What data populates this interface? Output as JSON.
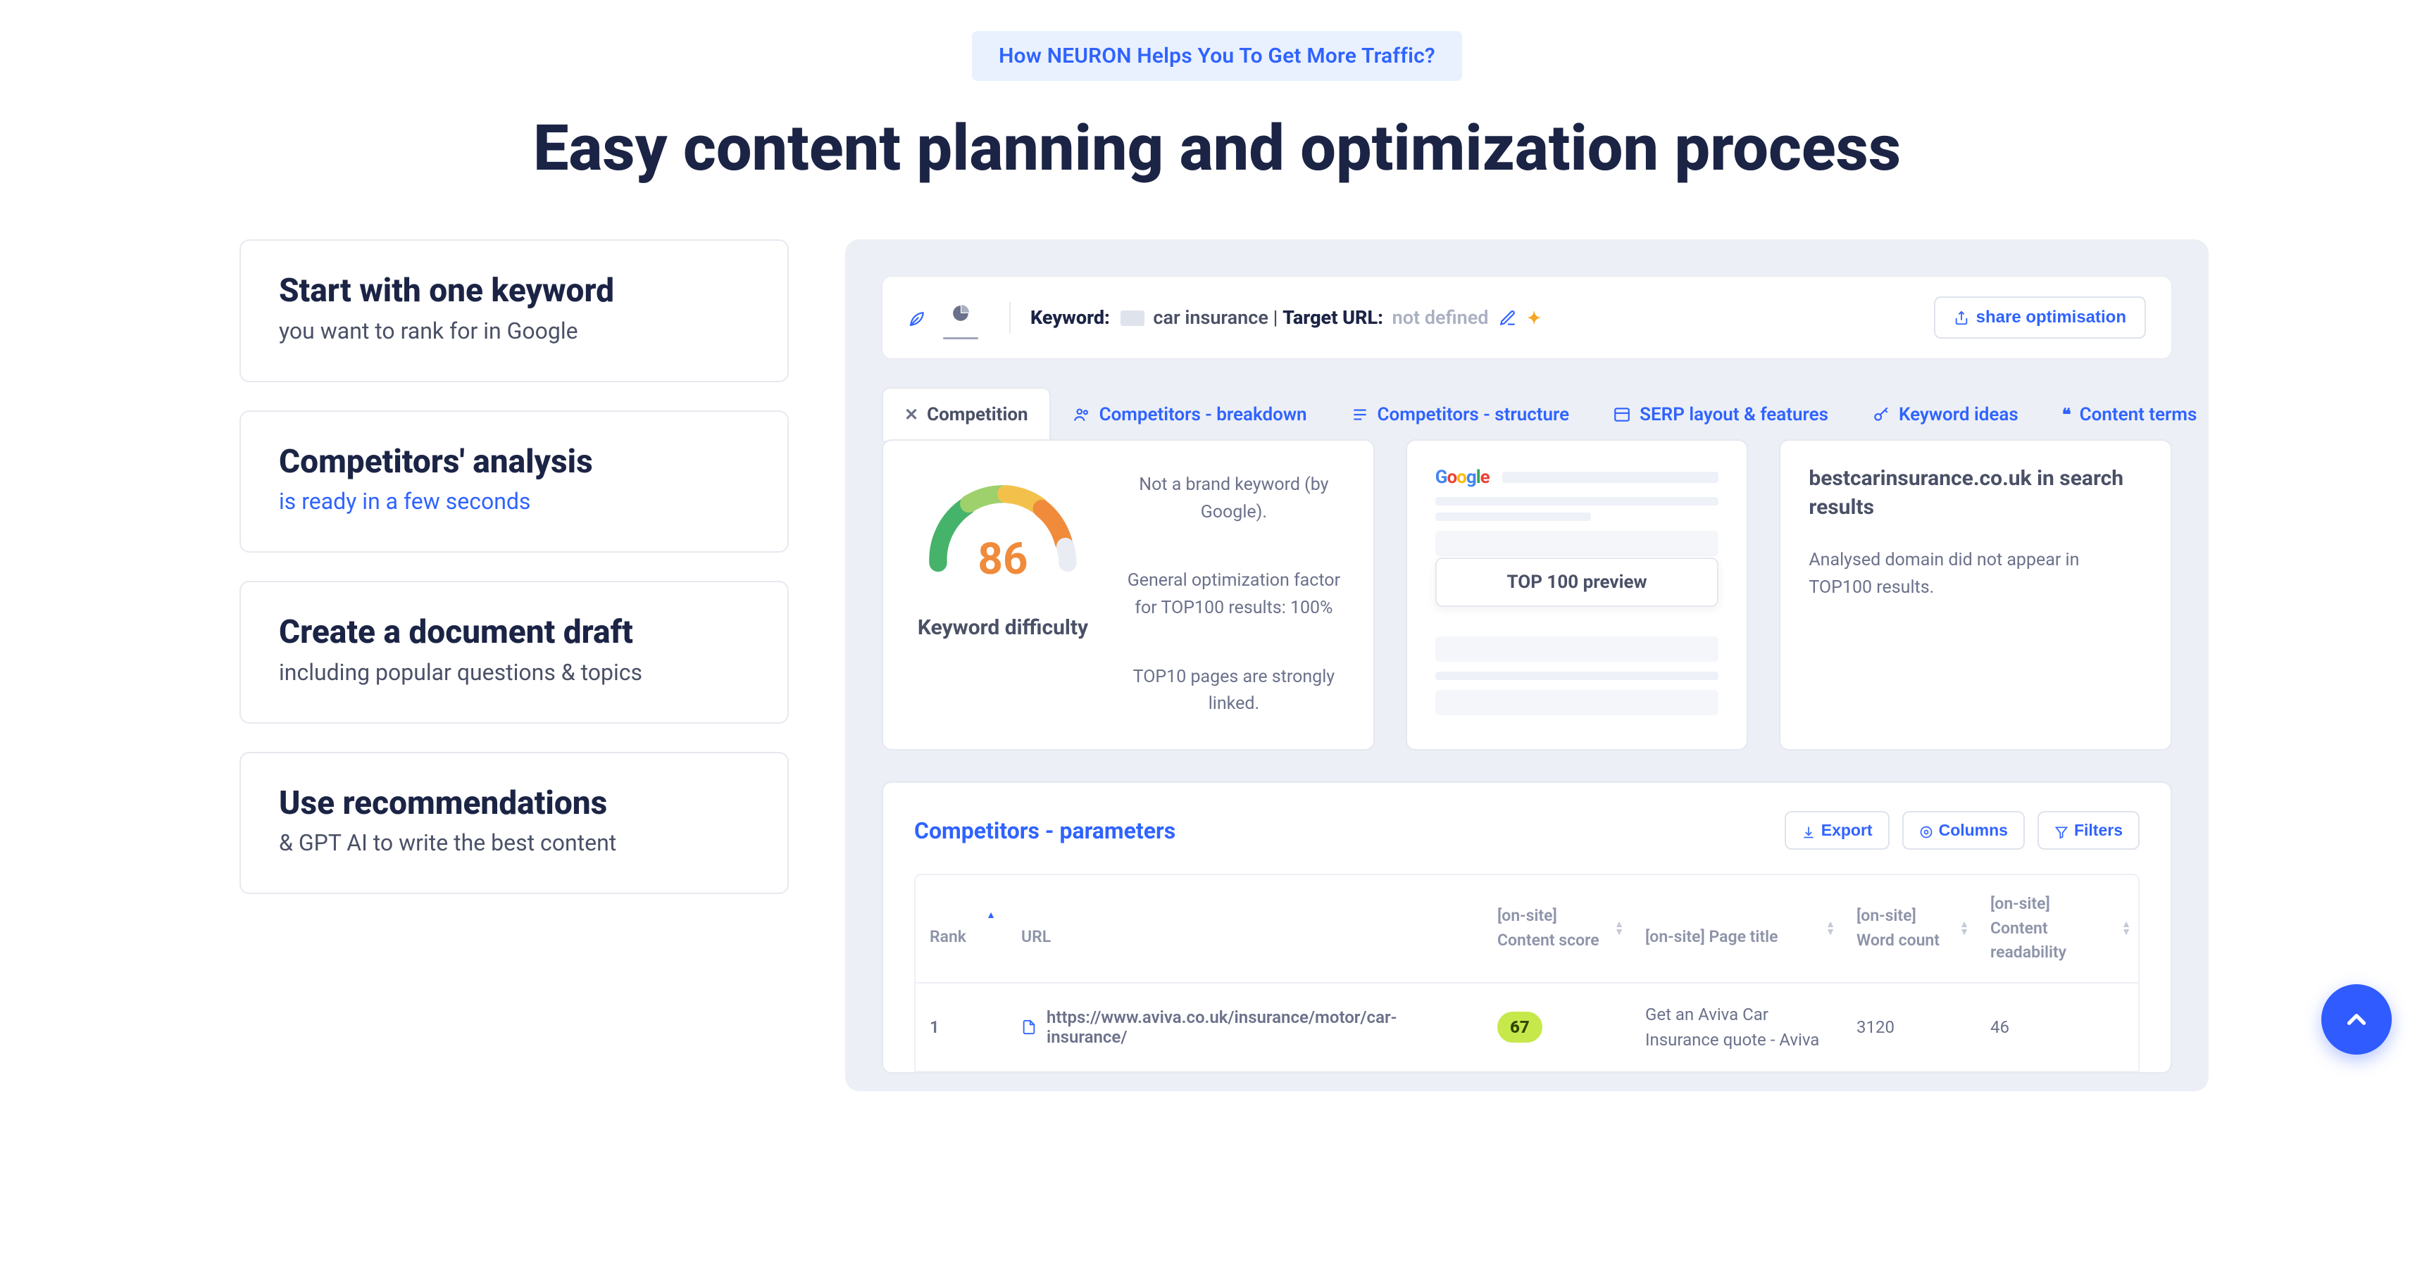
{
  "top_pill": "How NEURON Helps You To Get More Traffic?",
  "heading": "Easy content planning and optimization process",
  "steps": [
    {
      "title": "Start with one keyword",
      "sub": "you want to rank for in Google",
      "sub_style": "gray"
    },
    {
      "title": "Competitors' analysis",
      "sub": "is ready in a few seconds",
      "sub_style": "blue"
    },
    {
      "title": "Create a document draft",
      "sub": "including popular questions & topics",
      "sub_style": "gray"
    },
    {
      "title": "Use recommendations",
      "sub": "& GPT AI to write the best content",
      "sub_style": "gray"
    }
  ],
  "app": {
    "keyword_label": "Keyword:",
    "keyword_value": "car insurance",
    "target_label": "Target URL:",
    "target_value": "not defined",
    "share_label": "share optimisation",
    "tabs": [
      {
        "label": "Competition",
        "active": true
      },
      {
        "label": "Competitors - breakdown"
      },
      {
        "label": "Competitors - structure"
      },
      {
        "label": "SERP layout & features"
      },
      {
        "label": "Keyword ideas"
      },
      {
        "label": "Content terms"
      }
    ],
    "gauge": {
      "value": "86",
      "label": "Keyword difficulty",
      "line1": "Not a brand keyword (by Google).",
      "line2": "General optimization factor for TOP100 results: 100%",
      "line3": "TOP10 pages are strongly linked."
    },
    "serp": {
      "preview_btn": "TOP 100 preview"
    },
    "domain_card": {
      "title": "bestcarinsurance.co.uk in search results",
      "text": "Analysed domain did not appear in TOP100 results."
    },
    "comp_table": {
      "title": "Competitors - parameters",
      "buttons": {
        "export": "Export",
        "columns": "Columns",
        "filters": "Filters"
      },
      "headers": {
        "rank": "Rank",
        "url": "URL",
        "score": {
          "b": "[on-site]",
          "l": "Content score"
        },
        "ptitle": {
          "b": "",
          "l": "[on-site] Page title"
        },
        "wc": {
          "b": "[on-site]",
          "l": "Word count"
        },
        "read": {
          "b": "[on-site]",
          "l": "Content readability"
        }
      },
      "row": {
        "rank": "1",
        "url": "https://www.aviva.co.uk/insurance/motor/car-insurance/",
        "score": "67",
        "ptitle": "Get an Aviva Car Insurance quote - Aviva",
        "wc": "3120",
        "read": "46"
      }
    }
  }
}
